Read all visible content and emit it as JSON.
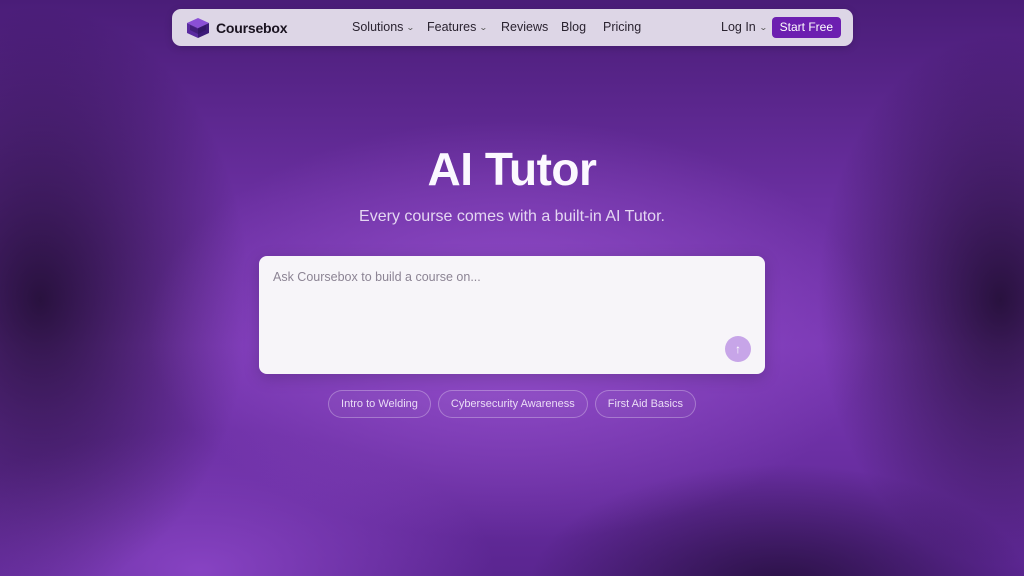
{
  "brand": {
    "name": "Coursebox"
  },
  "nav": {
    "items": [
      {
        "label": "Solutions",
        "dropdown": true
      },
      {
        "label": "Features",
        "dropdown": true
      },
      {
        "label": "Reviews",
        "dropdown": false
      },
      {
        "label": "Blog",
        "dropdown": false
      },
      {
        "label": "Pricing",
        "dropdown": false
      }
    ],
    "login_label": "Log In",
    "cta_label": "Start Free"
  },
  "hero": {
    "title": "AI Tutor",
    "subtitle": "Every course comes with a built-in AI Tutor."
  },
  "prompt": {
    "placeholder": "Ask Coursebox to build a course on...",
    "value": "",
    "send_icon": "arrow-up-icon"
  },
  "suggestions": [
    "Intro to Welding",
    "Cybersecurity Awareness",
    "First Aid Basics"
  ],
  "colors": {
    "accent": "#6c1fb0",
    "send_button": "#c7a5e8"
  }
}
